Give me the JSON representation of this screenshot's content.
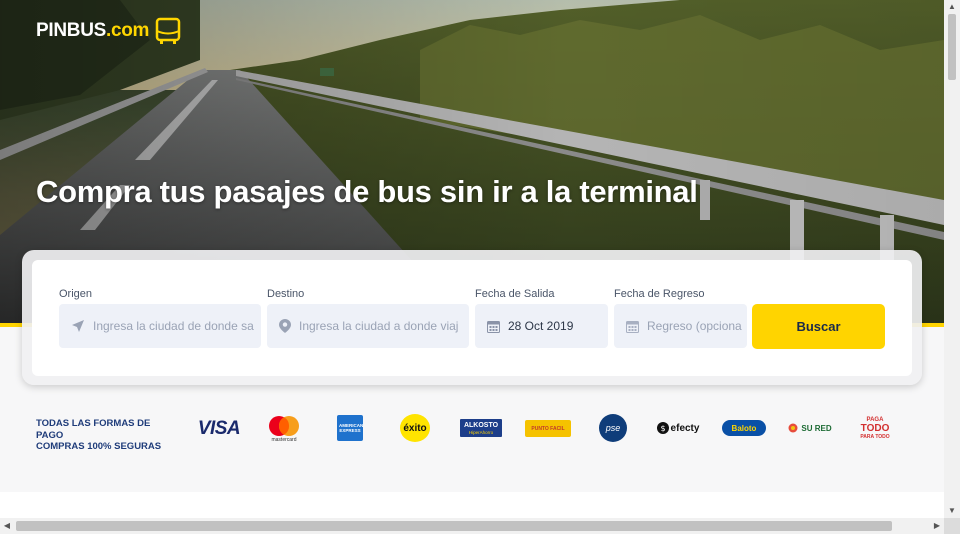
{
  "brand": {
    "name_main": "PINBUS",
    "name_suffix": ".com"
  },
  "hero": {
    "title": "Compra tus pasajes de bus sin ir a la terminal"
  },
  "search": {
    "origin": {
      "label": "Origen",
      "placeholder": "Ingresa la ciudad de donde sa",
      "icon": "location-arrow-icon"
    },
    "destination": {
      "label": "Destino",
      "placeholder": "Ingresa la ciudad a donde viaj",
      "icon": "map-pin-icon"
    },
    "departure": {
      "label": "Fecha de Salida",
      "value": "28 Oct 2019",
      "icon": "calendar-icon"
    },
    "return": {
      "label": "Fecha de Regreso",
      "placeholder": "Regreso (opciona",
      "icon": "calendar-icon"
    },
    "button_label": "Buscar"
  },
  "payments": {
    "line1": "TODAS LAS FORMAS DE PAGO",
    "line2": "COMPRAS 100% SEGURAS",
    "logos": {
      "visa": "VISA",
      "mastercard": "mastercard",
      "amex": "AMERICAN EXPRESS",
      "exito": "éxito",
      "alkosto": "ALKOSTO",
      "alkosto_sub": "HiperAhorro",
      "puntos": "PUNTO FACIL",
      "pse": "pse",
      "efecty": "efecty",
      "baloto": "Baloto",
      "sured": "SU RED",
      "pagatodo_1": "PAGA",
      "pagatodo_2": "TODO",
      "pagatodo_3": "PARA TODO"
    }
  },
  "colors": {
    "accent": "#ffd400",
    "navy": "#1f3c7a",
    "field_bg": "#eef1f8"
  }
}
